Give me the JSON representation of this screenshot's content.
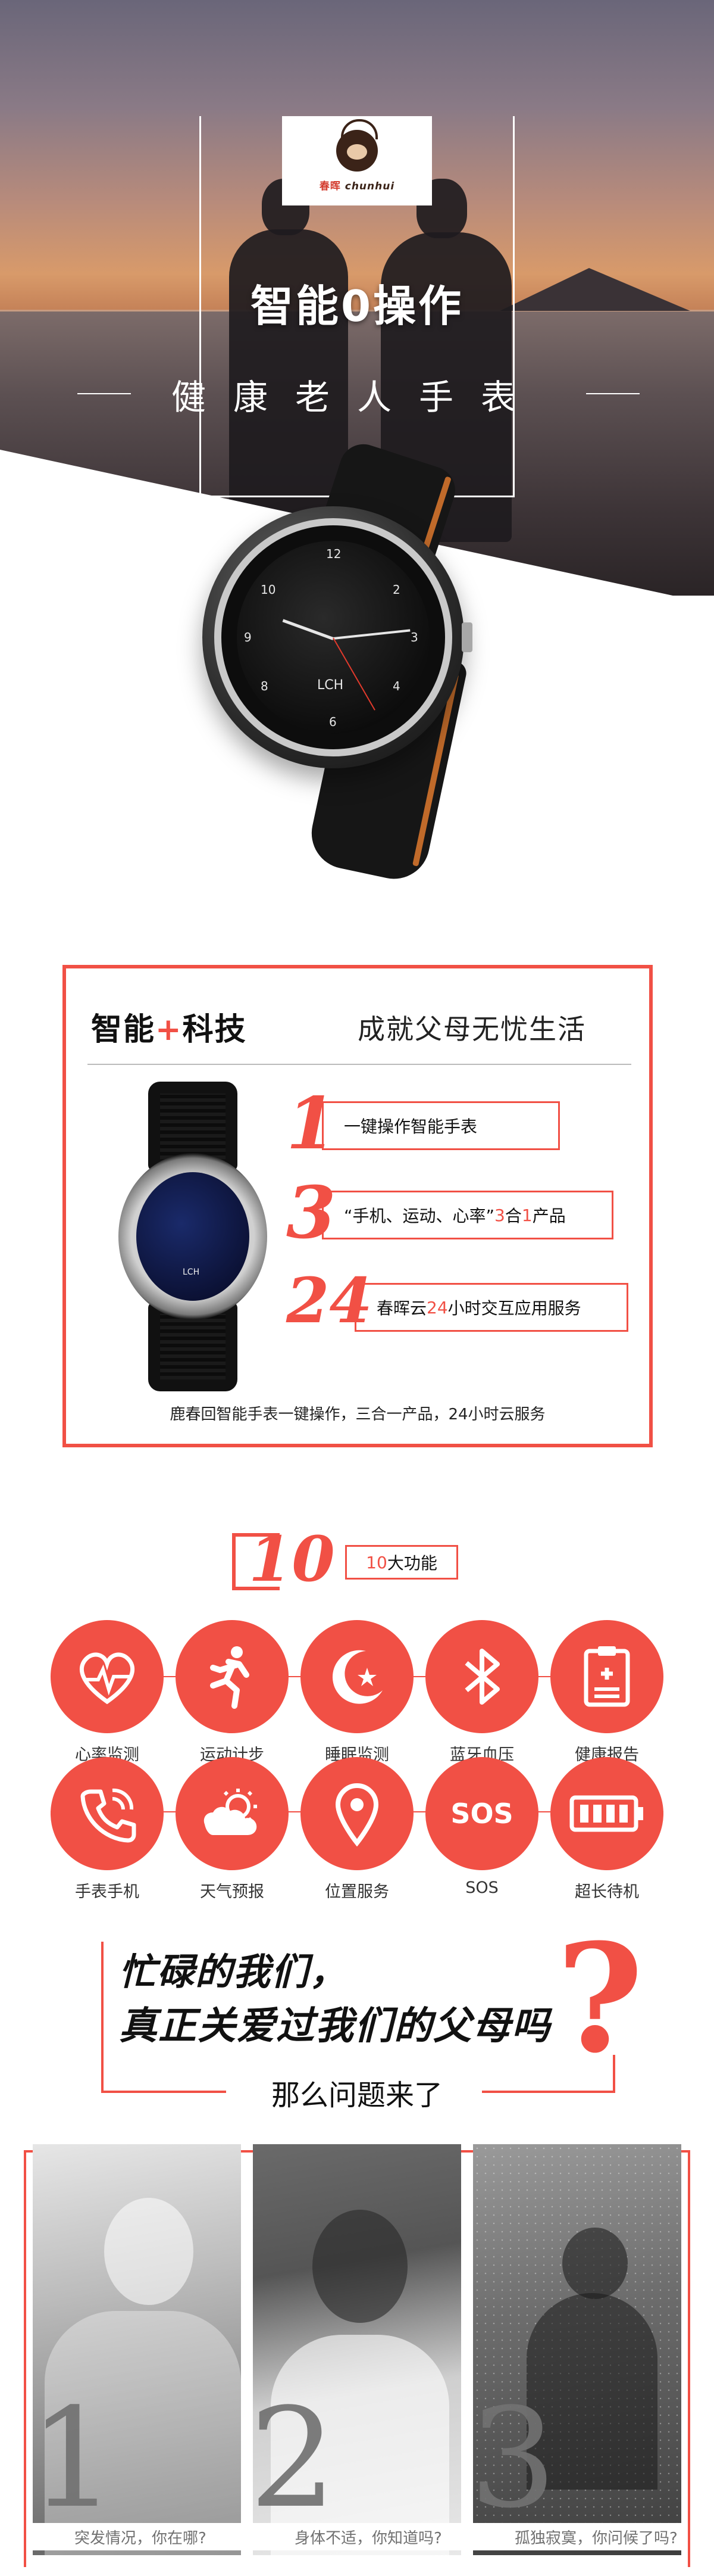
{
  "brand": {
    "cn": "春晖",
    "en": "chunhui"
  },
  "hero": {
    "title": "智能0操作",
    "subtitle": "健康老人手表"
  },
  "watch_label": "LCH",
  "tech": {
    "title_left": "智能",
    "title_plus": "+",
    "title_right": "科技",
    "slogan": "成就父母无忧生活",
    "features": [
      {
        "num": "1",
        "text": "一键操作智能手表"
      },
      {
        "num": "3",
        "text_a": "“手机、运动、心率” ",
        "text_hl1": "3",
        "text_b": "合",
        "text_hl2": "1",
        "text_c": "产品"
      },
      {
        "num": "24",
        "text_a": "春晖云",
        "text_hl": "24",
        "text_b": "小时交互应用服务"
      }
    ],
    "caption": "鹿春回智能手表一键操作，三合一产品，24小时云服务"
  },
  "functions": {
    "count": "10",
    "label_hl": "10",
    "label": "大功能",
    "items": [
      {
        "label": "心率监测",
        "icon": "heart-rate-icon"
      },
      {
        "label": "运动计步",
        "icon": "running-icon"
      },
      {
        "label": "睡眠监测",
        "icon": "moon-star-icon"
      },
      {
        "label": "蓝牙血压",
        "icon": "bluetooth-icon"
      },
      {
        "label": "健康报告",
        "icon": "report-icon"
      },
      {
        "label": "手表手机",
        "icon": "phone-icon"
      },
      {
        "label": "天气预报",
        "icon": "weather-icon"
      },
      {
        "label": "位置服务",
        "icon": "location-pin-icon"
      },
      {
        "label": "SOS",
        "icon": "sos-icon",
        "icon_text": "SOS"
      },
      {
        "label": "超长待机",
        "icon": "battery-icon"
      }
    ]
  },
  "question": {
    "line1": "忙碌的我们，",
    "line2": "真正关爱过我们的父母吗",
    "mark": "?",
    "sub": "那么问题来了"
  },
  "problems": [
    {
      "num": "1",
      "caption": "突发情况，你在哪?"
    },
    {
      "num": "2",
      "caption": "身体不适，你知道吗?"
    },
    {
      "num": "3",
      "caption": "孤独寂寞，你问候了吗?"
    }
  ],
  "colors": {
    "accent": "#f15045"
  }
}
